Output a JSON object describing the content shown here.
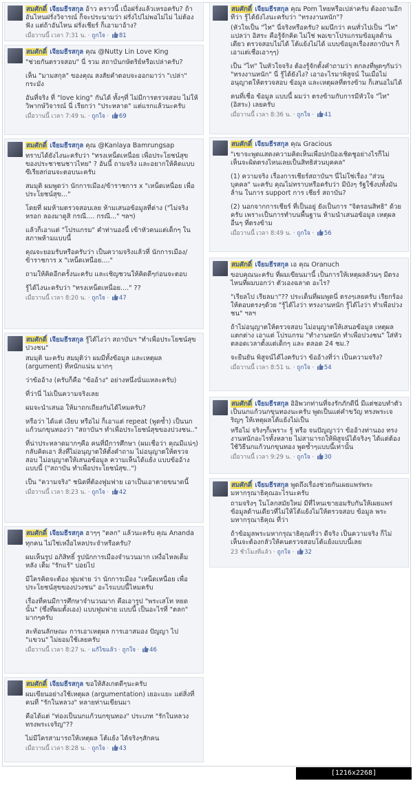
{
  "colors": {
    "link": "#3b5998",
    "highlight": "#f6e05c",
    "card_bg": "#f2f4f8"
  },
  "left": [
    {
      "name_hl": "สมศักดิ์",
      "name_rest": " เจียมธีรสกุล",
      "head": " อ้าว คราวนี้ เบื่อฝรั่งแล้วเหรอครับ? ถ้าอันไหนฝรั่งวิจารณ์ ก็จะประนามว่า ฝรั่งไปไม่พอไม่ไม่ ไม่ต้องฟัง แต่ถ้าอันไหน ฝรั่งเชียร์ ก็เอามาอ้าง?",
      "body": [],
      "time": "เมื่อวานนี้ เวลา 7:31 น.",
      "like": "ถูกใจ",
      "count": "81"
    },
    {
      "name_hl": "สมศักดิ์",
      "name_rest": " เจียมธีรสกุล",
      "head": " คุณ @Nutty Lin Love King",
      "body": [
        "\"ช่วยกันตรวจสอบ\" นี่ รวม สถาบันกษัตริย์หรือเปล่าครับ?",
        "เห็น \"มามสกุล\" ของคุณ สงสัยคำตอบจะออกมาว่า \"เปล่า\" กระมัง",
        "อันที่จริง ที่ \"love king\" กันได้ ทั้งๆที่ ไม่มีการตรวจสอบ ไม่ให้วิพากษ์วิจารณ์ นี่ เรียกว่า \"ประหลาด\" แต่แรกแล้วนะครับ"
      ],
      "time": "เมื่อวานนี้ เวลา 7:49 น.",
      "like": "ถูกใจ",
      "count": "69"
    },
    {
      "name_hl": "สมศักดิ์",
      "name_rest": " เจียมธีรสกุล",
      "head": " คุณ @Kanlaya Bamrungsap",
      "body": [
        "ทราบได้ยังไงนะครับว่า \"ทรงเหน็ดเหนื่อย เพื่อประโยชน์สุขของประชาชนชาวไทย\" ? อันนี้ ถามจริง และอยากให้คิดแบบซีเรียสก่อนจะตอบนะครับ",
        "สมมุติ ผมพูดว่า นักการเมือง/ข้าราชการ x \"เหน็ดเหนื่อย เพื่อประโยชน์สุข...\"",
        "โดยที่ ผมห้ามตรวจสอบเลย ห้ามเสนอข้อมูลที่ต่าง (\"ไม่จริง หรอก ลองมาดูสิ กรณี.... กรณี...\" ฯลฯ)",
        "แล้วก็เอาแต่ \"โปรแกรม\" คำท่านองนี้ เข้าหัวคนแต่เด็กๆ ในสภาพห้ามแบบนี้",
        "คุณจะยอมรับหรือครับว่า เป็นความจริงแล้วที่ นักการเมือง/ข้าราชการ x \"เหน็ดเหนื่อย....\"",
        "ถามให้คิดอีกครั้งนะครับ และเชิญชวนให้คิดดีๆก่อนจะตอบ",
        "รู้ได้ไงนะครับว่า \"ทรงเหน็ดเหนื่อย....\" ??"
      ],
      "time": "เมื่อวานนี้ เวลา 8:20 น.",
      "like": "ถูกใจ",
      "count": "47"
    },
    {
      "name_hl": "สมศักดิ์",
      "name_rest": " เจียมธีรสกุล",
      "head": " รู้ได้ไงว่า สถาบันฯ \"ทำเพื่อประโยชน์สุขปวงชน\"",
      "body": [
        "สมมุติ นะครับ สมมุติว่า ผมมีทั้งข้อมูล และเหตุผล (argument) ที่หนักแน่น มากๆ",
        "ว่าข้ออ้าง (ครับก็คือ \"ข้ออ้าง\" อย่างหนึ่งนั่นแหละครับ)",
        "ที่ว่านี่ ไม่เป็นความจริงเลย",
        "ผมจะนำเสนอ ให้มาถกเถียงกันได้ไหมครับ?",
        "หรือว่า ได้แต่ เงียบ หรือไม่ ก็เอาแต่ repeat (พูดซ้ำ) เป็นนกแก้วนกขุนทองว่า \"สถาบันฯ ทำเพื่อประโยชน์สุขของปวงชน..\"",
        "ที่น่าประหลาดมากๆคือ คนที่มีการศึกษา (ผมเชื่อว่า คุณมีแน่ๆ) กลับคิดเอา สิ่งที่ไม่อนุญาตให้ตั้งคำถาม ไม่อนุญาตให้ตรวจสอบ ไม่อนุญาตให้เสนอข้อมูล ความเห็นได้แย้ง แบบข้ออ้างแบบนี้ (\"สถาบัน ทำเพื่อประโยชน์สุข..\")",
        "เป็น \"ความจริง\" ชนิดที่ต้องฟูมฟาย เอาเป็นเอาตายขนาดนี้"
      ],
      "time": "เมื่อวานนี้ เวลา 8:23 น.",
      "like": "ถูกใจ",
      "count": "42"
    },
    {
      "name_hl": "สมศักดิ์",
      "name_rest": " เจียมธีรสกุล",
      "head": " ฮาๆๆ \"ตลก\" แล้วนะครับ คุณ Ananda",
      "body": [
        "ทุกคน ไม่ใช่เหงื่อไหลประจำหรือครับ?",
        "ผมเห็นรูป อภิสิทธิ์ รูปนักการเมืองจำนวนมาก เหงื่อไหลเต็มหลัง เต็ม \"รักแร้\" บ่อยไป",
        "มีใครคิดจะต้อง ฟูมฟาย ว่า นักการเมือง \"เหน็ดเหนื่อย เพื่อประโยชน์สุขของปวงชน\" อะไรแบบนี้ไหมครับ",
        "เรื่องที่คนมีการศึกษาจำนวนมาก คือเอารูป \"พระเสโท หยดนั้น\" (ซึ่งที่ผมตั้งเอง) แบบฟูมฟาย แบบนี้ เป็นอะไรที่ \"ตลก\" มากๆครับ",
        "สะท้อนลักษณะ การเอาเหตุผล การเอาสมอง ปัญญา ไป \"แขวน\" ไม่ยอมใช้เลยครับ"
      ],
      "time": "เมื่อวานนี้ เวลา 8:27 น.",
      "extra": " · แก้ไขแล้ว",
      "like": "ถูกใจ",
      "count": "46"
    },
    {
      "name_hl": "สมศักดิ์",
      "name_rest": " เจียมธีรสกุล",
      "head": " ขอให้สังเกตดีๆนะครับ",
      "body": [
        "ผมเขียนอย่างใช้เหตุผล (argumentation) เยอะแยะ แต่สิ่งที่คนที่ \"รักในหลวง\" หลายท่านเขียนมา",
        "คือได้แต่ \"ท่องเป็นนกแก้วนกขุนทอง\" ประเภท \"รักในหลวง ทรงพระเจริญ\"??",
        "ไม่มีใครสามารถให้เหตุผล โต้แย้ง ได้จริงๆสักคน"
      ],
      "time": "เมื่อวานนี้ เวลา 8:28 น.",
      "like": "ถูกใจ",
      "count": "43"
    }
  ],
  "right": [
    {
      "name_hl": "สมศักดิ์",
      "name_rest": " เจียมธีรสกุล",
      "head": " คุณ Pom ไทยหรือเปล่าครับ ต้องถามอีกทีว่า รู้ได้ยังไงนะครับว่า \"ทรงงานหนัก\"?",
      "body": [
        "(หัวใจเป็น \"ไท\" นี่จริงหรือครับ? ผมนึกว่า คนทั่วไปเป็น \"ไท\" แปลว่า อิสระ คือรู้จักคิด ไม่ใช่ พอเขาโปรแกรมข้อมูลด้านเดียว ตรวจสอบไม่ได้ โต้แย้งไม่ได้ แบบข้อมูลเรื่องสถาบันฯ ก็เอาแต่เชื่อเอาๆๆ)",
        "เป็น \"ไท\" ในหัวใจจริง ต้องรู้จักตั้งคำถามว่า ตกลงที่พูดๆกันว่า \"ทรงงานหนัก\" นี่ รู้ได้ยังไง? เอาอะไรมาพิสูจน์ ในเมื่อไม่อนุญาตให้ตรวจสอบ ข้อมูล และเหตุผลที่ตรงข้าม ก็เสนอไม่ได้",
        "คนที่เชื่อ ข้อมูล แบบนี้ ผมว่า ตรงข้ามกับการมีหัวใจ \"ไท\" (อิสระ) เลยครับ"
      ],
      "time": "เมื่อวานนี้ เวลา 8:36 น.",
      "like": "ถูกใจ",
      "count": "41"
    },
    {
      "name_hl": "สมศักดิ์",
      "name_rest": " เจียมธีรสกุล",
      "head": " คุณ Gracious",
      "body": [
        "\"เขาจะพูดแสดงความคิดเห็นเพื่อปกป้องเชิดชูอย่างไรก็ไม่เห็นจะผิดตรงไหนเลยเป็นสิทธิส่วนบุคคล\"",
        "(1) ความจริง เรื่องการเชียร์สถาบันฯ นี่ไม่ใช่เรื่อง \"ส่วนบุคคล\" นะครับ คุณไม่ทราบหรือครับว่า มีบังๆ รัฐใช้งบทั้งมันล้าน ในการ support การ เชียร์ สถาบัน?",
        "(2) นอกจากการเชียร์ ที่เป็นอยู่ ยังเป็นการ \"จิตรอนสิทธิ\" ด้วยครับ เพราะเป็นการทำบนพื้นฐาน ห้ามนำเสนอข้อมูล เหตุผลอื่นๆ ที่ตรงข้าม"
      ],
      "time": "เมื่อวานนี้ เวลา 8:49 น.",
      "like": "ถูกใจ",
      "count": "56"
    },
    {
      "name_hl": "สมศักดิ์",
      "name_rest": " เจียมธีรสกุล",
      "head": " เอ คุณ Oranuch",
      "body": [
        "ขอบคุณนะครับ ที่ผมเขียนมานี้ เป็นการให้เหตุผลล้วนๆ มีตรงไหนที่ผมบอกว่า ตัวเองฉลาด อะไร?",
        "\"เรียลไป เรียลมา\"?? ประเด็นที่ผมพูดนี่ ตรงๆเลยครับ เรียกร้องให้ตอบตรงๆด้วย \"รู้ได้ไงว่า ทรงงานหนัก รู้ได้ไงว่า ทำเพื่อปวงชน\" ฯลฯ",
        "ถ้าไม่อนุญาตให้ตรวจสอบ ไม่อนุญาตให้เสนอข้อมูล เหตุผลแตกต่าง เอาแต่ โปรแกรม \"ทำงานหนัก ทำเพื่อปวงชน\" ใส่หัว ตลอดเวลาตั้งแต่เด็กๆ และ ตลอด 24 ชม.?",
        "จะยืนยัน พิสูจน์ได้ไงครับว่า ข้ออ้างที่ว่า เป็นความจริง?"
      ],
      "time": "เมื่อวานนี้ เวลา 8:51 น.",
      "like": "ถูกใจ",
      "count": "54"
    },
    {
      "name_hl": "สมศักดิ์",
      "name_rest": " เจียมธีรสกุล",
      "head": " อิอิพวกท่านที่จงรักภักดีนี่ มีแต่ชอบทำตัวเป็นนกแก้วนกขุนทองนะครับ พูดเป็นแต่คำขวัญ ทรงพระเจริญๆ ให้เหตุผลโต้แย้งไม่เป็น",
      "body": [
        "หรือไม่ จริงๆก็เพราะ รู้ หรือ จนปัญญาว่า ข้ออ้างท่านอง ทรงงานหนักอะไรทั้งหลาย ไม่สามารถให้พิสูจน์ได้จริงๆ ได้แต่ต้องใช้วิธีนกแก้วนกขุนทอง พูดซ้ำๆแบบนี้เท่านั้น"
      ],
      "time": "เมื่อวานนี้ เวลา 9:29 น.",
      "like": "ถูกใจ",
      "count": "30"
    },
    {
      "name_hl": "สมศักดิ์",
      "name_rest": " เจียมธีรสกุล",
      "head": " พูดถึงเรื่องช่วยกันเผยแพร่พระมหากรุณาธิคุณอะไรนะครับ",
      "body": [
        "ถามจริงๆ ในโลกสมัยใหม่ มีที่ไหนเขายอมรับกันให้เผยแพร่ ข้อมูลด้านเดียวที่ไม่ให้โต้แย้งไม่ให้ตรวจสอบ ข้อมูล พระมหากรุณาธิคุณ ที่ว่า",
        "ถ้าข้อมูลพระมหากรุณาธิคุณที่ว่า ดีจริง เป็นความจริง ก็ไม่เห็นจะต้องกลัวให้คนตรวจสอบโต้แย้งแบบนี้เลย"
      ],
      "time": "23 ชั่วโมงที่แล้ว",
      "like": "ถูกใจ",
      "count": "32"
    }
  ],
  "footer": "[1216x2268] https://upic.me/"
}
